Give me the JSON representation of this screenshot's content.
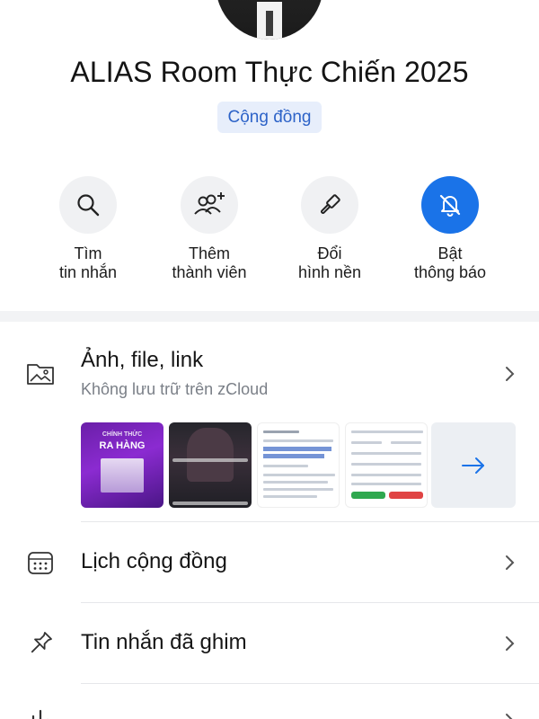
{
  "group": {
    "name": "ALIAS Room Thực Chiến 2025",
    "badge": "Cộng đồng"
  },
  "actions": [
    {
      "id": "search",
      "label": "Tìm\ntin nhắn",
      "icon": "search-icon"
    },
    {
      "id": "add-member",
      "label": "Thêm\nthành viên",
      "icon": "add-people-icon"
    },
    {
      "id": "wallpaper",
      "label": "Đổi\nhình nền",
      "icon": "paint-brush-icon"
    },
    {
      "id": "notifications",
      "label": "Bật\nthông báo",
      "icon": "bell-off-icon"
    }
  ],
  "media": {
    "title": "Ảnh, file, link",
    "subtitle": "Không lưu trữ trên zCloud",
    "thumb1_line1": "CHÍNH THỨC",
    "thumb1_line2": "RA HÀNG"
  },
  "menu": [
    {
      "label": "Lịch cộng đồng",
      "icon": "calendar-icon"
    },
    {
      "label": "Tin nhắn đã ghim",
      "icon": "pin-icon"
    }
  ],
  "colors": {
    "accent": "#1a73e8",
    "badge_bg": "#e7eefb",
    "badge_text": "#2d63c8"
  }
}
